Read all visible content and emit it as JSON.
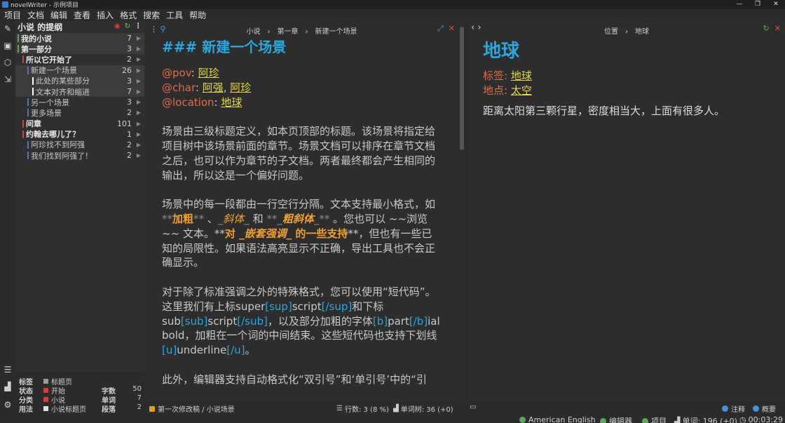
{
  "window": {
    "title": "novelWriter - 示例项目"
  },
  "menu": [
    "项目",
    "文档",
    "编辑",
    "查看",
    "插入",
    "格式",
    "搜索",
    "工具",
    "帮助"
  ],
  "tree": {
    "title": "小说 的提纲",
    "items": [
      {
        "label": "我的小说",
        "count": "7",
        "color": "#5aa85a"
      },
      {
        "label": "第一部分",
        "count": "3",
        "color": "#5aa85a"
      },
      {
        "label": "所以它开始了",
        "count": "2",
        "color": "#d04040"
      },
      {
        "label": "新建一个场景",
        "count": "26",
        "color": "#5577aa"
      },
      {
        "label": "此处的某些部分",
        "count": "3",
        "color": "#ffffff"
      },
      {
        "label": "文本对齐和缩进",
        "count": "7",
        "color": "#ffffff"
      },
      {
        "label": "另一个场景",
        "count": "3",
        "color": "#5577aa"
      },
      {
        "label": "更多场景",
        "count": "2",
        "color": "#5577aa"
      },
      {
        "label": "间章",
        "count": "101",
        "color": "#d04040"
      },
      {
        "label": "约翰去哪儿了？",
        "count": "1",
        "color": "#d04040"
      },
      {
        "label": "阿珍找不到阿强",
        "count": "2",
        "color": "#5577aa"
      },
      {
        "label": "我们找到阿强了！",
        "count": "2",
        "color": "#5577aa"
      }
    ]
  },
  "stats": {
    "labels": [
      "标签",
      "状态",
      "分类",
      "用法"
    ],
    "values": [
      {
        "text": "标题页",
        "color": "#9a9a9a"
      },
      {
        "text": "开始",
        "color": "#d04040"
      },
      {
        "text": "小说",
        "color": "#d04040"
      },
      {
        "text": "小说标题页",
        "color": "#e0e0e0"
      }
    ],
    "counts": [
      {
        "label": "字数",
        "value": "50"
      },
      {
        "label": "单词",
        "value": "7"
      },
      {
        "label": "段落",
        "value": "2"
      }
    ]
  },
  "editor": {
    "breadcrumb": "小说　›　第一章　›　新建一个场景",
    "heading_marker": "###",
    "heading": "新建一个场景",
    "meta": [
      {
        "key": "@pov",
        "values": [
          "阿珍"
        ]
      },
      {
        "key": "@char",
        "values": [
          "阿强",
          "阿珍"
        ]
      },
      {
        "key": "@location",
        "values": [
          "地球"
        ]
      }
    ],
    "p1": "场景由三级标题定义，如本页顶部的标题。该场景将指定给项目树中该场景前面的章节。场景文档可以排序在章节文档之后，也可以作为章节的子文档。两者最终都会产生相同的输出，所以这是一个偏好问题。",
    "p2": {
      "a": "场景中的每一段都由一行空行分隔。文本支持最小格式，如 ",
      "bold": "加粗",
      "b": " 、",
      "italic": "斜体",
      "c": " 和 ",
      "bolditalic": "粗斜体",
      "d": " 。您也可以 ~~浏览~~ 文本。**",
      "nested1": "对 ",
      "nested2": "嵌套强调",
      "nested3": " 的一些支持",
      "e": "**，但也有一些已知的局限性。如果语法高亮显示不正确，导出工具也不会正确显示。"
    },
    "p3": {
      "a": "对于除了标准强调之外的特殊格式，您可以使用“短代码”。这里我们有上标super",
      "sup1": "[sup]",
      "sup_text": "script",
      "sup2": "[/sup]",
      "b": "和下标sub",
      "sub1": "[sub]",
      "sub_text": "script",
      "sub2": "[/sub]",
      "c": "，以及部分加粗的字体",
      "b1": "[b]",
      "b_text": "part",
      "b2": "[/b]",
      "d": "ial bold，加粗在一个词的中间结束。这些短代码也支持下划线",
      "u1": "[u]",
      "u_text": "underline",
      "u2": "[/u]",
      "e": "。"
    },
    "p4": "此外，编辑器支持自动格式化“双引号”和‘单引号’中的“引"
  },
  "viewer": {
    "breadcrumb": "位置　›　地球",
    "title": "地球",
    "tags_label": "标签:",
    "tags_value": "地球",
    "location_label": "地点:",
    "location_value": "太空",
    "text": "距离太阳第三颗行星，密度相当大，上面有很多人。"
  },
  "status": {
    "doc_status": "第一次修改稿 / 小说场景",
    "lines": "行数: 3 (8 %)",
    "words": "单词树: 36 (+0)",
    "language": "American English",
    "editor": "编辑器",
    "project": "项目",
    "wordcount": "单词: 196 (+0)",
    "time": "00:03:29",
    "comments": "注释",
    "synopsis": "概要"
  }
}
